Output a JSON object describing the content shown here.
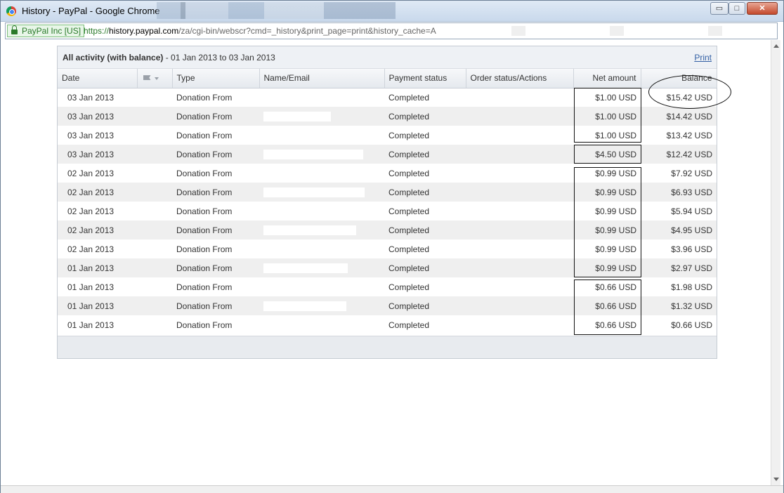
{
  "window": {
    "title": "History - PayPal - Google Chrome",
    "controls": {
      "minimize": "▭",
      "maximize": "□",
      "close": "✕"
    }
  },
  "address": {
    "secure_label": "PayPal Inc [US]",
    "url_protocol": "https://",
    "url_host": "history.paypal.com",
    "url_path": "/za/cgi-bin/webscr?cmd=_history&print_page=print&history_cache=A"
  },
  "panel": {
    "title_bold": "All activity (with balance)",
    "date_range": " - 01 Jan 2013 to 03 Jan 2013",
    "print_label": "Print"
  },
  "table": {
    "headers": {
      "date": "Date",
      "type": "Type",
      "name": "Name/Email",
      "payment_status": "Payment status",
      "order_status": "Order status/Actions",
      "net_amount": "Net amount",
      "balance": "Balance"
    },
    "rows": [
      {
        "date": "03 Jan 2013",
        "type": "Donation From",
        "status": "Completed",
        "net": "$1.00 USD",
        "balance": "$15.42 USD"
      },
      {
        "date": "03 Jan 2013",
        "type": "Donation From",
        "status": "Completed",
        "net": "$1.00 USD",
        "balance": "$14.42 USD"
      },
      {
        "date": "03 Jan 2013",
        "type": "Donation From",
        "status": "Completed",
        "net": "$1.00 USD",
        "balance": "$13.42 USD"
      },
      {
        "date": "03 Jan 2013",
        "type": "Donation From",
        "status": "Completed",
        "net": "$4.50 USD",
        "balance": "$12.42 USD"
      },
      {
        "date": "02 Jan 2013",
        "type": "Donation From",
        "status": "Completed",
        "net": "$0.99 USD",
        "balance": "$7.92 USD"
      },
      {
        "date": "02 Jan 2013",
        "type": "Donation From",
        "status": "Completed",
        "net": "$0.99 USD",
        "balance": "$6.93 USD"
      },
      {
        "date": "02 Jan 2013",
        "type": "Donation From",
        "status": "Completed",
        "net": "$0.99 USD",
        "balance": "$5.94 USD"
      },
      {
        "date": "02 Jan 2013",
        "type": "Donation From",
        "status": "Completed",
        "net": "$0.99 USD",
        "balance": "$4.95 USD"
      },
      {
        "date": "02 Jan 2013",
        "type": "Donation From",
        "status": "Completed",
        "net": "$0.99 USD",
        "balance": "$3.96 USD"
      },
      {
        "date": "01 Jan 2013",
        "type": "Donation From",
        "status": "Completed",
        "net": "$0.99 USD",
        "balance": "$2.97 USD"
      },
      {
        "date": "01 Jan 2013",
        "type": "Donation From",
        "status": "Completed",
        "net": "$0.66 USD",
        "balance": "$1.98 USD"
      },
      {
        "date": "01 Jan 2013",
        "type": "Donation From",
        "status": "Completed",
        "net": "$0.66 USD",
        "balance": "$1.32 USD"
      },
      {
        "date": "01 Jan 2013",
        "type": "Donation From",
        "status": "Completed",
        "net": "$0.66 USD",
        "balance": "$0.66 USD"
      }
    ]
  },
  "icons": {
    "flag_column": "flag-icon",
    "secure": "lock-icon",
    "browser": "chrome-icon"
  },
  "colors": {
    "link": "#315fa4",
    "secure_green": "#2a7a2a",
    "alt_row": "#efefef"
  }
}
